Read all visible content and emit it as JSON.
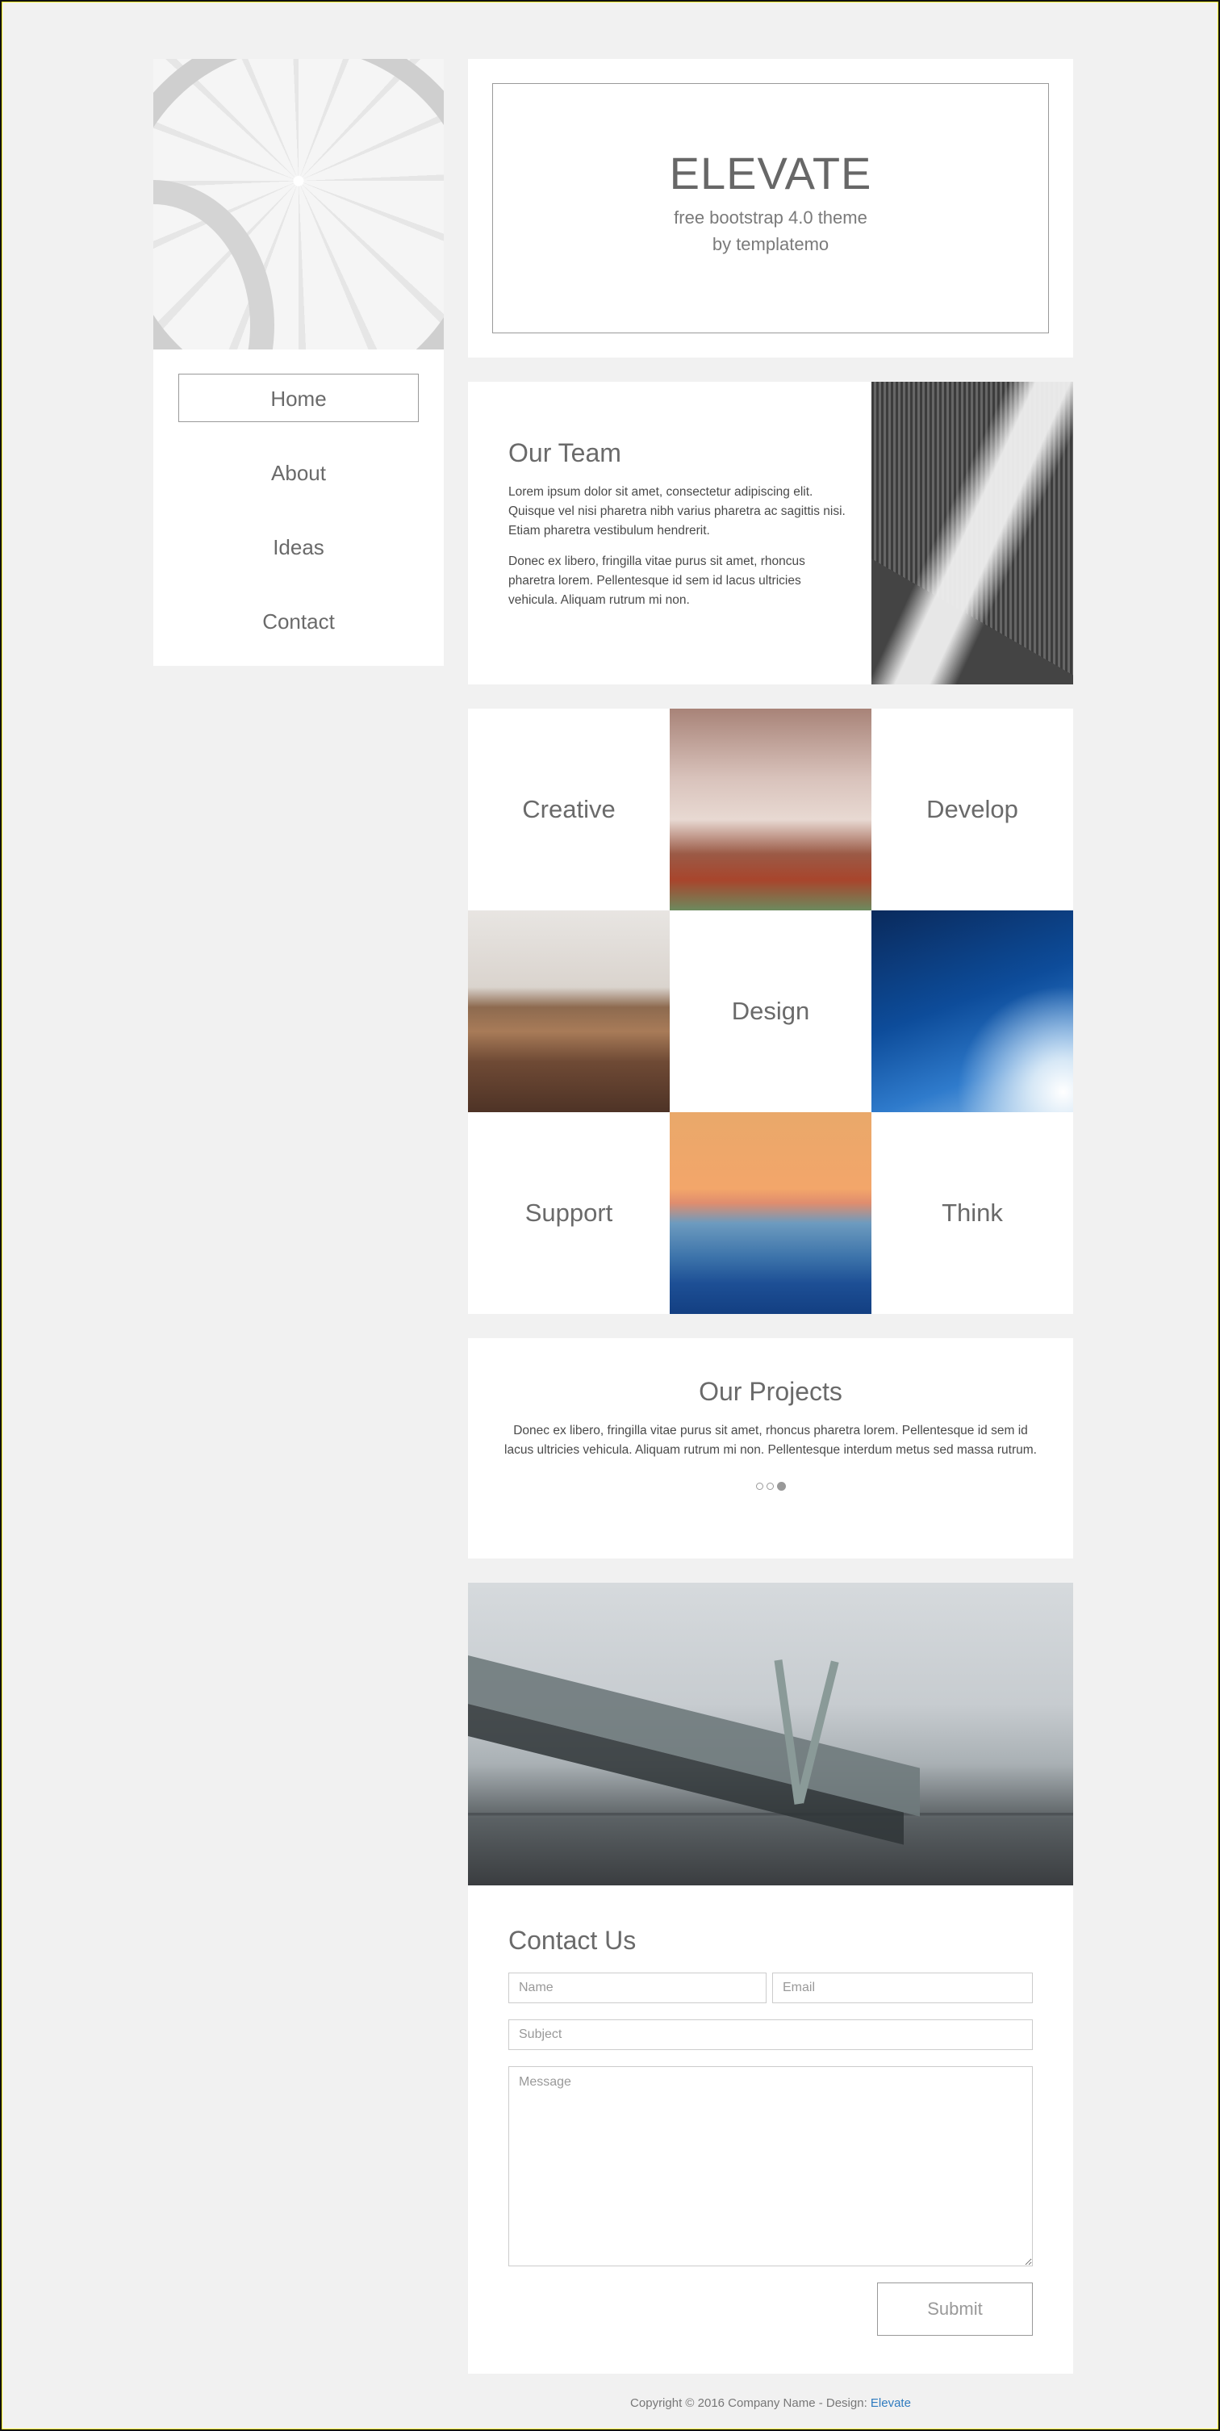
{
  "nav": {
    "items": [
      {
        "label": "Home",
        "active": true
      },
      {
        "label": "About",
        "active": false
      },
      {
        "label": "Ideas",
        "active": false
      },
      {
        "label": "Contact",
        "active": false
      }
    ]
  },
  "hero": {
    "title": "ELEVATE",
    "subtitle_line1": "free bootstrap 4.0 theme",
    "subtitle_line2": "by templatemo"
  },
  "team": {
    "heading": "Our Team",
    "paragraph1": "Lorem ipsum dolor sit amet, consectetur adipiscing elit. Quisque vel nisi pharetra nibh varius pharetra ac sagittis nisi. Etiam pharetra vestibulum hendrerit.",
    "paragraph2": "Donec ex libero, fringilla vitae purus sit amet, rhoncus pharetra lorem. Pellentesque id sem id lacus ultricies vehicula. Aliquam rutrum mi non."
  },
  "grid": {
    "labels": [
      "Creative",
      "Develop",
      "Design",
      "Support",
      "Think"
    ],
    "images": [
      "forest-path-image",
      "desert-dunes-image",
      "birds-sky-image",
      "mountain-sunset-image"
    ]
  },
  "projects": {
    "heading": "Our Projects",
    "text": "Donec ex libero, fringilla vitae purus sit amet, rhoncus pharetra lorem. Pellentesque id sem id lacus ultricies vehicula. Aliquam rutrum mi non. Pellentesque interdum metus sed massa rutrum.",
    "slides": 3,
    "active_slide": 3
  },
  "contact": {
    "heading": "Contact Us",
    "name_placeholder": "Name",
    "email_placeholder": "Email",
    "subject_placeholder": "Subject",
    "message_placeholder": "Message",
    "submit_label": "Submit"
  },
  "footer": {
    "text": "Copyright © 2016 Company Name - Design: ",
    "link_label": "Elevate",
    "link_color": "#2f7bbf"
  },
  "colors": {
    "background": "#f1f1f1",
    "panel": "#ffffff",
    "text": "#666666",
    "border": "#999999"
  }
}
